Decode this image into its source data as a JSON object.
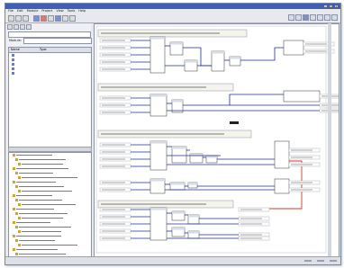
{
  "window": {
    "title": "",
    "buttons": [
      "–",
      "□",
      "×"
    ]
  },
  "menu": [
    "File",
    "Edit",
    "Module",
    "Project",
    "View",
    "Tools",
    "Help"
  ],
  "left_panel": {
    "name_label": "Module:",
    "name_value": "",
    "list_columns": [
      "Name",
      "Type"
    ],
    "list_items": [
      {
        "name": "",
        "type": ""
      },
      {
        "name": "",
        "type": ""
      },
      {
        "name": "",
        "type": ""
      },
      {
        "name": "",
        "type": ""
      },
      {
        "name": "",
        "type": ""
      }
    ]
  },
  "status": [
    "",
    "",
    ""
  ],
  "colors": {
    "title_bar": "#3f5fb5",
    "wire": "#1f2f8a",
    "highlight_wire": "#d23a2a",
    "block_fill": "#ffffff",
    "comment_fill": "#f4f4ec"
  }
}
